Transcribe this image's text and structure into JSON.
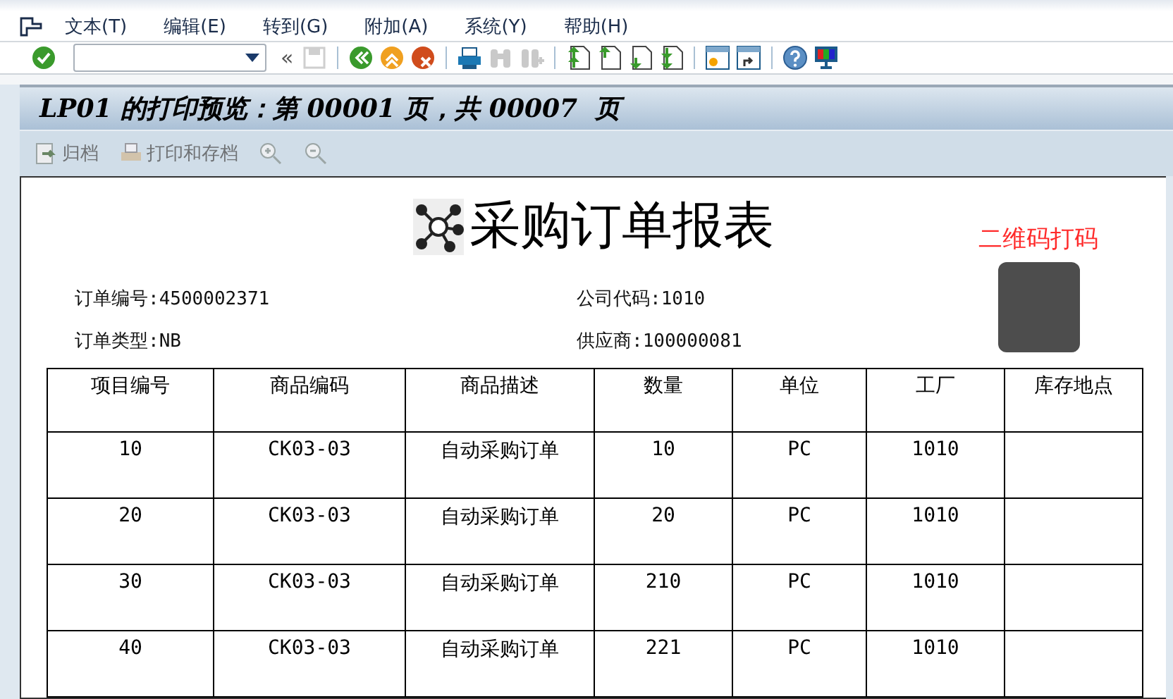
{
  "menu": [
    {
      "label": "文本(T)"
    },
    {
      "label": "编辑(E)"
    },
    {
      "label": "转到(G)"
    },
    {
      "label": "附加(A)"
    },
    {
      "label": "系统(Y)"
    },
    {
      "label": "帮助(H)"
    }
  ],
  "toolbar": {
    "history_glyph": "«",
    "icons": [
      {
        "kind": "save",
        "disabled": true
      },
      {
        "kind": "sep"
      },
      {
        "kind": "back",
        "disabled": false
      },
      {
        "kind": "exit",
        "disabled": false
      },
      {
        "kind": "cancel",
        "disabled": false
      },
      {
        "kind": "sep"
      },
      {
        "kind": "print",
        "disabled": false
      },
      {
        "kind": "find",
        "disabled": true
      },
      {
        "kind": "findnext",
        "disabled": true
      },
      {
        "kind": "sep"
      },
      {
        "kind": "first",
        "disabled": false
      },
      {
        "kind": "prev",
        "disabled": false
      },
      {
        "kind": "next",
        "disabled": false
      },
      {
        "kind": "last",
        "disabled": false
      },
      {
        "kind": "sep"
      },
      {
        "kind": "newsession",
        "disabled": false
      },
      {
        "kind": "shortcut",
        "disabled": false
      },
      {
        "kind": "sep"
      },
      {
        "kind": "help",
        "disabled": false
      },
      {
        "kind": "layout",
        "disabled": false
      }
    ]
  },
  "title": "LP01 的打印预览：第 00001 页，共 00007  页",
  "app_toolbar": [
    {
      "kind": "archive",
      "label": "归档",
      "disabled": true
    },
    {
      "kind": "printarchive",
      "label": "打印和存档",
      "disabled": true
    },
    {
      "kind": "zoomin",
      "disabled": true
    },
    {
      "kind": "zoomout",
      "disabled": true
    }
  ],
  "document": {
    "heading": "采购订单报表",
    "qr_label": "二维码打码",
    "fields": [
      {
        "text": "订单编号:4500002371"
      },
      {
        "text": "公司代码:1010"
      },
      {
        "text": "订单类型:NB"
      },
      {
        "text": "供应商:100000081"
      }
    ],
    "table": {
      "columns": [
        "项目编号",
        "商品编码",
        "商品描述",
        "数量",
        "单位",
        "工厂",
        "库存地点"
      ],
      "rows": [
        [
          "10",
          "CK03-03",
          "自动采购订单",
          "10",
          "PC",
          "1010",
          ""
        ],
        [
          "20",
          "CK03-03",
          "自动采购订单",
          "20",
          "PC",
          "1010",
          ""
        ],
        [
          "30",
          "CK03-03",
          "自动采购订单",
          "210",
          "PC",
          "1010",
          ""
        ],
        [
          "40",
          "CK03-03",
          "自动采购订单",
          "221",
          "PC",
          "1010",
          ""
        ]
      ]
    }
  }
}
